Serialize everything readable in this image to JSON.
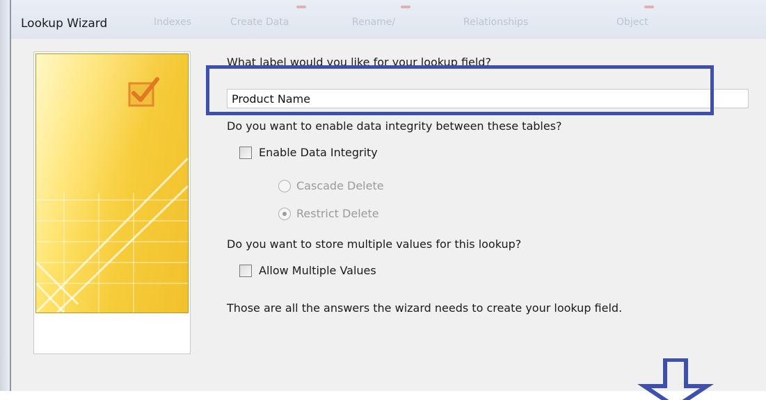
{
  "window": {
    "title": "Lookup Wizard"
  },
  "background_ribbon": {
    "items": [
      "Indexes",
      "Create Data",
      "Rename/",
      "Relationships",
      "Object"
    ]
  },
  "wizard": {
    "label_question": "What label would you like for your lookup field?",
    "label_value": "Product Name",
    "integrity_question": "Do you want to enable data integrity between these tables?",
    "enable_integrity_label": "Enable Data Integrity",
    "enable_integrity_checked": false,
    "cascade_delete_label": "Cascade Delete",
    "restrict_delete_label": "Restrict Delete",
    "selected_delete_option": "Restrict Delete",
    "multiple_values_question": "Do you want to store multiple values for this lookup?",
    "allow_multiple_label": "Allow Multiple Values",
    "allow_multiple_checked": false,
    "closing_note": "Those are all the answers the wizard needs to create your lookup field."
  },
  "colors": {
    "highlight": "#3f4fae",
    "arrow": "#3f4fae",
    "graphic_yellow": "#f6cc3a"
  },
  "icons": {
    "wizard_graphic": "checkmark-box-icon",
    "arrow": "down-arrow-icon"
  }
}
